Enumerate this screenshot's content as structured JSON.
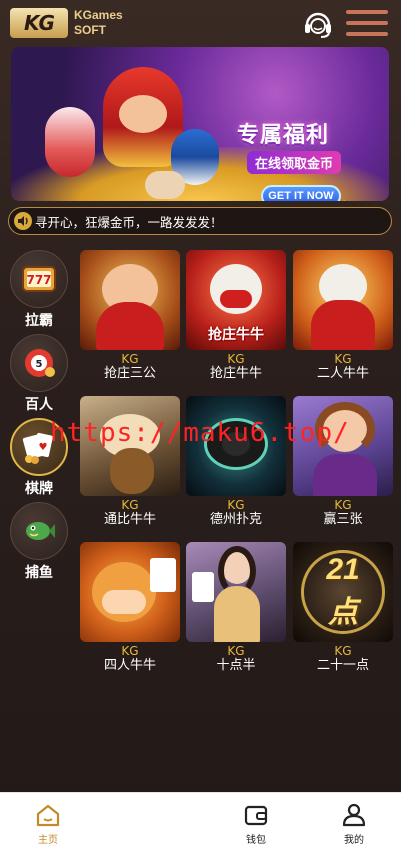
{
  "header": {
    "brand_name_line1": "KGames",
    "brand_name_line2": "SOFT",
    "logo_mark": "KG",
    "icons": [
      "headset-icon",
      "menu-icon"
    ]
  },
  "banner": {
    "title": "专属福利",
    "subtitle": "在线领取金币",
    "cta": "GET IT NOW"
  },
  "marquee": {
    "text": "寻开心，狂爆金币，一路发发发！"
  },
  "categories": [
    {
      "label": "拉霸",
      "icon": "slot-777-icon"
    },
    {
      "label": "百人",
      "icon": "lottery-ball-icon"
    },
    {
      "label": "棋牌",
      "icon": "poker-cards-icon",
      "active": true
    },
    {
      "label": "捕鱼",
      "icon": "fish-icon"
    }
  ],
  "games": [
    {
      "brand": "KG",
      "name": "抢庄三公"
    },
    {
      "brand": "KG",
      "name": "抢庄牛牛",
      "tag": "抢庄牛牛"
    },
    {
      "brand": "KG",
      "name": "二人牛牛"
    },
    {
      "brand": "KG",
      "name": "通比牛牛"
    },
    {
      "brand": "KG",
      "name": "德州扑克"
    },
    {
      "brand": "KG",
      "name": "赢三张"
    },
    {
      "brand": "KG",
      "name": "四人牛牛"
    },
    {
      "brand": "KG",
      "name": "十点半"
    },
    {
      "brand": "KG",
      "name": "二十一点",
      "tag": "21点"
    }
  ],
  "watermark": "https://maku6.top/",
  "bottom_nav": [
    {
      "label": "主页",
      "icon": "home-icon",
      "active": true
    },
    {
      "label": "钱包",
      "icon": "wallet-icon"
    },
    {
      "label": "我的",
      "icon": "user-icon"
    }
  ],
  "colors": {
    "accent_gold": "#e7b83c",
    "nav_active": "#c48a2a",
    "background": "#2a1f1c"
  }
}
